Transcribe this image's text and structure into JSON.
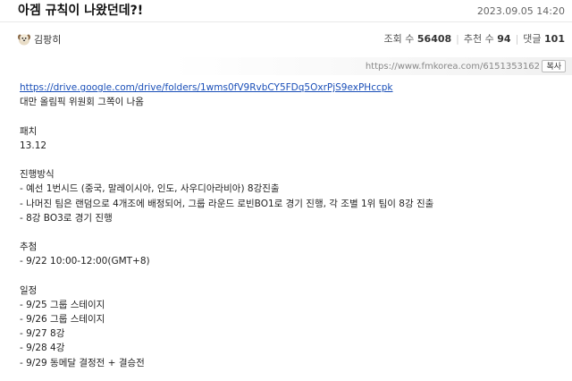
{
  "post": {
    "title": "아겜 규칙이 나왔던데?!",
    "date": "2023.09.05 14:20"
  },
  "author": {
    "name": "김팡히"
  },
  "stats": {
    "views_label": "조회 수",
    "views": "56408",
    "recommend_label": "추천 수",
    "recommend": "94",
    "comments_label": "댓글",
    "comments": "101"
  },
  "share": {
    "url": "https://www.fmkorea.com/6151353162",
    "copy_label": "복사"
  },
  "content": {
    "link": "https://drive.google.com/drive/folders/1wms0fV9RvbCY5FDq5OxrPjS9exPHccpk",
    "lines": [
      "대만 올림픽 위원회 그쪽이 나옴",
      "",
      "패치",
      "13.12",
      "",
      "진행방식",
      "- 예선 1번시드 (중국, 말레이시아, 인도, 사우디아라비아) 8강진출",
      "- 나머진 팀은 랜덤으로 4개조에 배정되어, 그룹 라운드 로빈BO1로 경기 진행, 각 조별 1위 팀이 8강 진출",
      "- 8강 BO3로 경기 진행",
      "",
      "추첨",
      "- 9/22 10:00-12:00(GMT+8)",
      "",
      "일정",
      "- 9/25 그룹 스테이지",
      "- 9/26 그룹 스테이지",
      "- 9/27 8강",
      "- 9/28 4강",
      "- 9/29 동메달 결정전 + 결승전"
    ]
  }
}
